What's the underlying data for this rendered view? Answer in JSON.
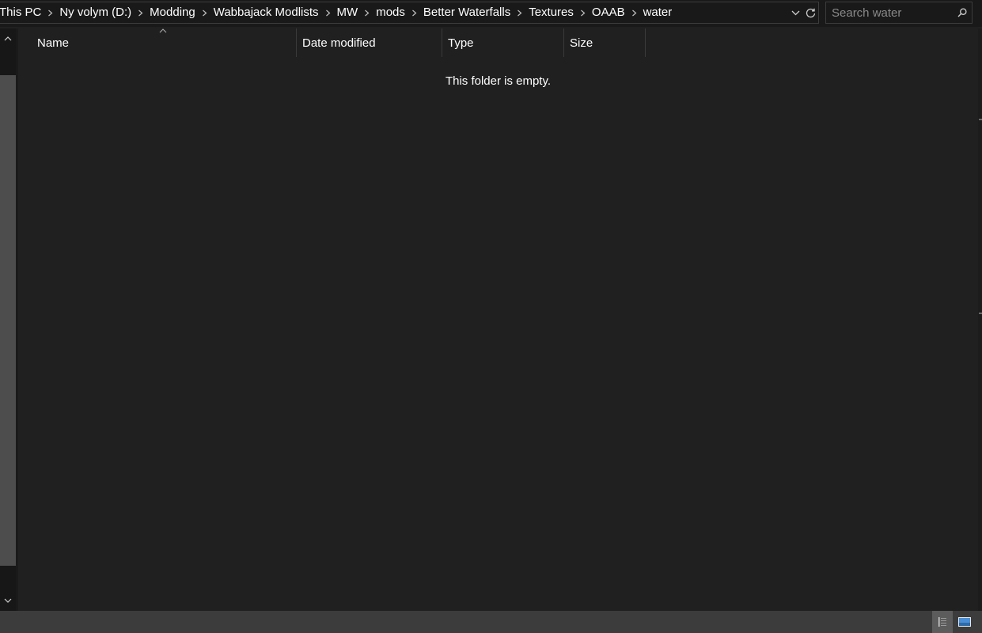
{
  "address_bar": {
    "crumbs": [
      "This PC",
      "Ny volym (D:)",
      "Modding",
      "Wabbajack Modlists",
      "MW",
      "mods",
      "Better Waterfalls",
      "Textures",
      "OAAB",
      "water"
    ]
  },
  "search": {
    "placeholder": "Search water"
  },
  "columns": {
    "name": "Name",
    "date_modified": "Date modified",
    "type": "Type",
    "size": "Size"
  },
  "file_list": {
    "empty_message": "This folder is empty."
  },
  "icons": {
    "breadcrumb_separator": "chevron-right-icon",
    "address_dropdown": "chevron-down-icon",
    "refresh": "refresh-icon",
    "search": "search-icon",
    "sort": "sort-ascending-icon",
    "scroll_up": "chevron-up-icon",
    "scroll_down": "chevron-down-icon",
    "details_view": "details-view-icon",
    "thumbnails_view": "large-icons-view-icon"
  },
  "colors": {
    "background": "#202020",
    "address_bg": "#191919",
    "border": "#3c3c3c",
    "statusbar": "#3c3c3c",
    "scroll_thumb": "#4d4d4d",
    "text": "#ffffff",
    "placeholder": "#8a8a8a"
  }
}
